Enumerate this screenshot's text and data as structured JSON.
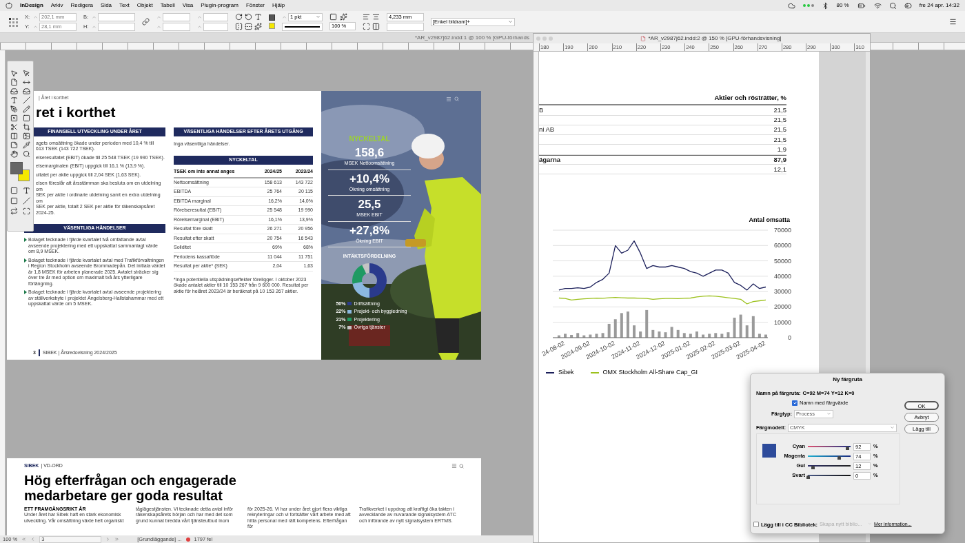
{
  "menubar": {
    "app": "InDesign",
    "menus": [
      "Arkiv",
      "Redigera",
      "Sida",
      "Text",
      "Objekt",
      "Tabell",
      "Visa",
      "Plugin-program",
      "Fönster",
      "Hjälp"
    ],
    "battery": "80 %",
    "clock": "fre 24 apr. 14:32"
  },
  "control_bar": {
    "x": {
      "label": "X:",
      "value": "202,1 mm"
    },
    "y": {
      "label": "Y:",
      "value": "28,1 mm"
    },
    "w_label": "B:",
    "h_label": "H:",
    "stroke_weight": "1 pkt",
    "scale": "100 %",
    "corner_size": "4,233 mm",
    "object_style": "[Enkel bildram]+"
  },
  "doc1": {
    "tab_title": "*AR_v2987j62.indd:1 @ 100 % [GPU-förhands",
    "spread": {
      "breadcrumb": "| Året i korthet",
      "title": "ret i korthet",
      "left_col": {
        "header": "FINANSIELL UTVECKLING UNDER ÅRET",
        "paragraphs": [
          [
            "agets omsättning ökade under perioden med 10,4 % till",
            "613 TSEK (143 722 TSEK)."
          ],
          [
            "elseresultatet (EBIT) ökade till 25 548 TSEK (19 990 TSEK)."
          ],
          [
            "elsemarginalen (EBIT) uppgick till 16,1 % (13,9 %)."
          ],
          [
            "ultatet per aktie uppgick till 2,04 SEK (1,63 SEK)."
          ],
          [
            "elsen föreslår att årsstämman ska besluta om en utdelning om",
            "SEK per aktie i ordinarie utdelning samt en extra utdelning om",
            "SEK per aktie, totalt 2 SEK per aktie för räkenskapsåret 2024-25."
          ]
        ],
        "header2": "VÄSENTLIGA HÄNDELSER",
        "bullets": [
          "Bolaget tecknade i fjärde kvartalet två omfattande avtal avseende projektering med ett uppskattat sammanlagt värde om 8,9 MSEK.",
          "Bolaget tecknade i fjärde kvartalet avtal med Trafikförvaltningen i Region Stockholm avseende Brommadepån. Det initiala värdet är 1,8 MSEK för arbeten planerade 2025. Avtalet sträcker sig över tre år med option om maximalt två års ytterligare förlängning.",
          "Bolaget tecknade i fjärde kvartalet avtal avseende projektering av ställverksbyte i projektet Ängelsberg-Hallstahammar med ett uppskattat värde om 5 MSEK."
        ]
      },
      "right_col": {
        "header": "VÄSENTLIGA HÄNDELSER EFTER ÅRETS UTGÅNG",
        "text": "Inga väsentliga händelser.",
        "table_header": "NYCKELTAL",
        "columns": [
          "TSEK om inte annat anges",
          "2024/25",
          "2023/24"
        ],
        "rows": [
          [
            "Nettoomsättning",
            "158 613",
            "143 722"
          ],
          [
            "EBITDA",
            "25 764",
            "20 115"
          ],
          [
            "EBITDA marginal",
            "16,2%",
            "14,0%"
          ],
          [
            "Rörelseresultat (EBIT)",
            "25 548",
            "19 990"
          ],
          [
            "Rörelsemarginal (EBIT)",
            "16,1%",
            "13,9%"
          ],
          [
            "Resultat före skatt",
            "26 271",
            "20 956"
          ],
          [
            "Resultat efter skatt",
            "20 754",
            "16 543"
          ],
          [
            "Soliditet",
            "69%",
            "68%"
          ],
          [
            "Periodens kassaflöde",
            "11 044",
            "11 751"
          ],
          [
            "Resultat per aktie* (SEK)",
            "2,04",
            "1,63"
          ]
        ],
        "footnote": "*Inga potentiella utspädningseffekter föreligger. I oktober 2023 ökade antalet aktier till 10 153 267 från 9 600 000. Resultat per aktie för helåret 2023/24 är beräknat på 10 153 267 aktier."
      },
      "footer": {
        "page": "3",
        "text": "SIBEK | Årsredovisning 2024/2025"
      },
      "photo_panel": {
        "title": "NYCKELTAL",
        "stats": [
          {
            "value": "158,6",
            "label": "MSEK Nettoomsättning"
          },
          {
            "value": "+10,4%",
            "label": "Ökning omsättning"
          },
          {
            "value": "25,5",
            "label": "MSEK EBIT"
          },
          {
            "value": "+27,8%",
            "label": "Ökning EBIT"
          }
        ],
        "chart_data": {
          "type": "donut",
          "title": "INTÄKTSFÖRDELNING",
          "legend": "bottom",
          "categories": [
            "Driftsättning",
            "Projekt- och byggledning",
            "Projektering",
            "Övriga tjänster"
          ],
          "values": [
            50,
            22,
            21,
            7
          ]
        },
        "legend": [
          {
            "percent": "50%",
            "color": "#2a3a8c"
          },
          {
            "percent": "22%",
            "color": "#8bb8e0"
          },
          {
            "percent": "21%",
            "color": "#1f9a63"
          },
          {
            "percent": "7%",
            "color": "#c4c4c4"
          }
        ]
      }
    },
    "page2": {
      "logo": "SIBEK",
      "section": "| VD-ORD",
      "heading": "Hög efterfrågan och engagerade medarbetare ger goda resultat",
      "columns": [
        {
          "subheading": "ETT FRAMGÅNGSRIKT ÅR",
          "text": "Under året har Sibek haft en stark ekonomisk utveckling. Vår omsättning växte helt organiskt"
        },
        {
          "text": "tåglägestjänsten. Vi tecknade detta avtal inför räkenskapsårets början och har med det som grund kunnat bredda vårt tjänsteutbud inom"
        },
        {
          "text": "för 2025-26. Vi har under året gjort flera viktiga rekryteringar och vi fortsätter vårt arbete med att hitta personal med rätt kompetens. Efterfrågan för"
        },
        {
          "text": "Trafikverket i uppdrag att kraftigt öka takten i avvecklande av nuvarande signalsystem ATC och införande av nytt signalsystem ERTMS."
        }
      ]
    },
    "status_bar": {
      "zoom": "100 %",
      "page": "3",
      "style": "[Grundläggande] ...",
      "errors": "1797 fel"
    }
  },
  "doc2": {
    "title": "*AR_v2987j62.indd:2 @ 150 % [GPU-förhandsvisning]",
    "ruler": [
      "180",
      "190",
      "200",
      "210",
      "220",
      "230",
      "240",
      "250",
      "260",
      "270",
      "280",
      "290",
      "300",
      "310"
    ],
    "table": {
      "heading": "Aktier och rösträtter, %",
      "rows": [
        {
          "label": "B",
          "value": "21,5",
          "kind": "row"
        },
        {
          "value": "21,5",
          "kind": "row"
        },
        {
          "label": "ni AB",
          "value": "21,5",
          "kind": "row"
        },
        {
          "value": "21,5",
          "kind": "row"
        },
        {
          "value": "1,9",
          "kind": "row"
        },
        {
          "label": "ägarna",
          "value": "87,9",
          "kind": "total"
        },
        {
          "value": "12,1",
          "kind": "row"
        }
      ]
    },
    "chart": {
      "chart_data": {
        "type": "line",
        "ylabel": "Antal omsatta",
        "ylim": [
          0,
          70000
        ],
        "grid": true,
        "legend": "bottom",
        "yticks": [
          0,
          10000,
          20000,
          30000,
          40000,
          50000,
          60000,
          70000
        ],
        "categories": [
          null,
          "24-08-02",
          null,
          null,
          null,
          "2024-09-02",
          null,
          null,
          null,
          "2024-10-02",
          null,
          null,
          null,
          "2024-11-02",
          null,
          null,
          null,
          "2024-12-02",
          null,
          null,
          null,
          "2025-01-02",
          null,
          null,
          null,
          "2025-02-02",
          null,
          null,
          null,
          "2025-03-02",
          null,
          null,
          null,
          "2025-04-02"
        ],
        "series": [
          {
            "name": "Sibek",
            "color": "#1b1f5a",
            "values": [
              31000,
              32000,
              32000,
              32500,
              32000,
              33000,
              36000,
              38000,
              42000,
              60000,
              55000,
              57000,
              63000,
              55000,
              45000,
              47000,
              46000,
              46000,
              47000,
              46000,
              45000,
              43000,
              42000,
              40000,
              42000,
              44000,
              44000,
              42000,
              36000,
              34000,
              31000,
              35000,
              32000,
              33000
            ]
          },
          {
            "name": "OMX Stockholm All-Share Cap_GI",
            "color": "#9cc11c",
            "values": [
              25800,
              25500,
              24500,
              25000,
              25300,
              25500,
              25700,
              25600,
              26000,
              26200,
              26000,
              25800,
              25800,
              25600,
              25500,
              25000,
              25300,
              25500,
              25500,
              25400,
              25600,
              25800,
              26500,
              27000,
              27200,
              27000,
              26500,
              26000,
              25500,
              25000,
              22000,
              23500,
              24000,
              24500
            ]
          },
          {
            "type": "bar",
            "color": "#9a9a9a",
            "values": [
              1500,
              2500,
              1800,
              3000,
              1500,
              2000,
              2500,
              3000,
              9000,
              12000,
              16000,
              17000,
              8000,
              4000,
              18000,
              5000,
              4000,
              3500,
              7000,
              5000,
              3000,
              2500,
              4000,
              2000,
              2500,
              3000,
              2500,
              3500,
              13000,
              15000,
              8000,
              14000,
              2500,
              2000
            ]
          }
        ]
      }
    }
  },
  "dialog": {
    "title": "Ny färgruta",
    "name_label": "Namn på färgruta:",
    "name_value": "C=92 M=74 Y=12 K=0",
    "name_with_value": {
      "label": "Namn med färgvärde",
      "checked": true
    },
    "type": {
      "label": "Färgtyp:",
      "value": "Process"
    },
    "model": {
      "label": "Färgmodell:",
      "value": "CMYK"
    },
    "sliders": [
      {
        "label": "Cyan",
        "value": "92",
        "unit": "%",
        "level": 0.92
      },
      {
        "label": "Magenta",
        "value": "74",
        "unit": "%",
        "level": 0.74
      },
      {
        "label": "Gul",
        "value": "12",
        "unit": "%",
        "level": 0.12
      },
      {
        "label": "Svart",
        "value": "0",
        "unit": "%",
        "level": 0
      }
    ],
    "buttons": [
      "OK",
      "Avbryt",
      "Lägg till"
    ],
    "cc_library": {
      "label": "Lägg till i CC Bibliotek:",
      "checked": false,
      "select": "Skapa nytt biblio...",
      "select_disabled": true,
      "link": "Mer information..."
    }
  }
}
